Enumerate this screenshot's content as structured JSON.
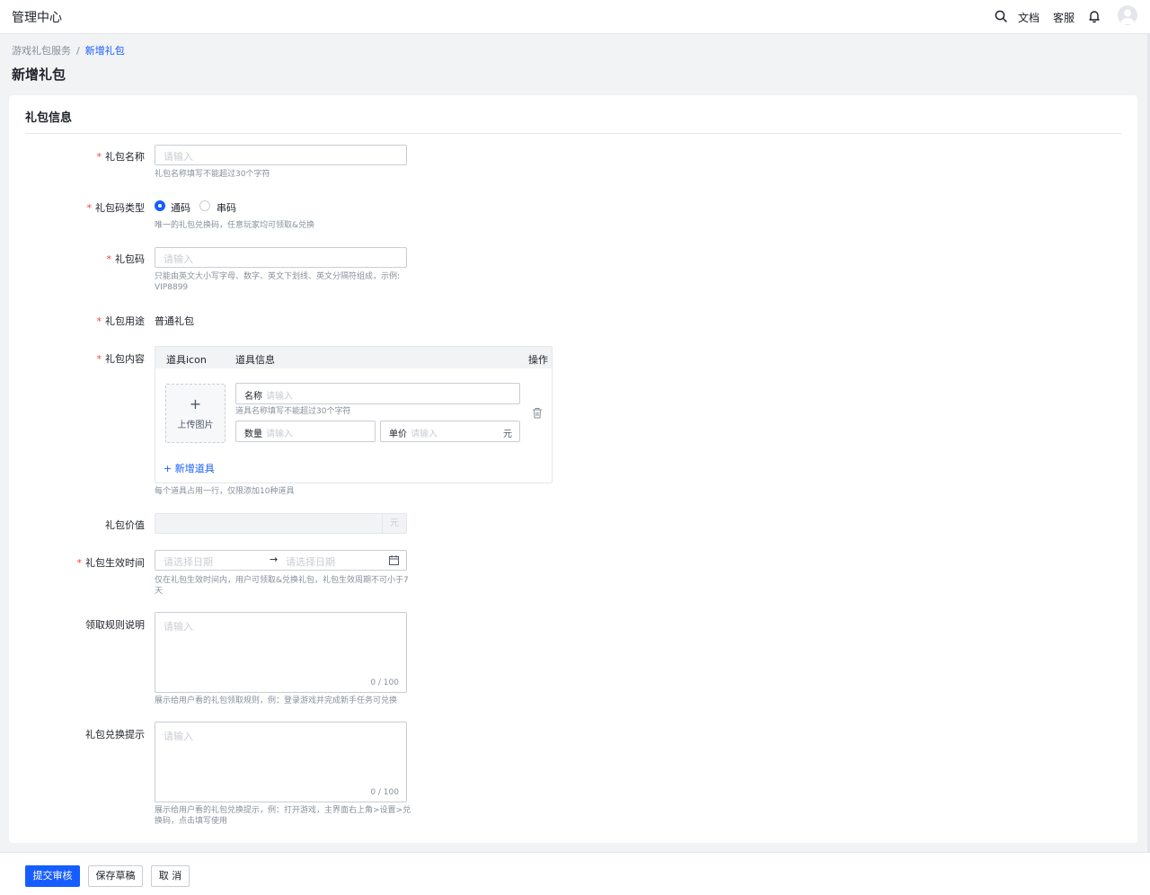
{
  "app": {
    "title": "管理中心"
  },
  "topbar": {
    "docs_label": "文档",
    "support_label": "客服"
  },
  "breadcrumb": {
    "parent": "游戏礼包服务",
    "separator": "/",
    "current": "新增礼包"
  },
  "page_title": "新增礼包",
  "section_title": "礼包信息",
  "form": {
    "name": {
      "label": "礼包名称",
      "placeholder": "请输入",
      "hint": "礼包名称填写不能超过30个字符"
    },
    "code_type": {
      "label": "礼包码类型",
      "options": [
        "通码",
        "串码"
      ],
      "selected": "通码",
      "hint": "唯一的礼包兑换码，任意玩家均可领取&兑换"
    },
    "code": {
      "label": "礼包码",
      "placeholder": "请输入",
      "hint_line1": "只能由英文大小写字母、数字、英文下划线、英文分隔符组成，示例:",
      "hint_line2": "VIP8899"
    },
    "usage": {
      "label": "礼包用途",
      "value": "普通礼包"
    },
    "content": {
      "label": "礼包内容",
      "columns": [
        "道具icon",
        "道具信息",
        "操作"
      ],
      "upload_label": "上传图片",
      "upload_plus": "+",
      "item_name_label": "名称",
      "item_name_placeholder": "请输入",
      "item_name_hint": "道具名称填写不能超过30个字符",
      "qty_label": "数量",
      "qty_placeholder": "请输入",
      "price_label": "单价",
      "price_placeholder": "请输入",
      "price_suffix": "元",
      "add_item": "+ 新增道具",
      "hint": "每个道具占用一行，仅限添加10种道具"
    },
    "value": {
      "label": "礼包价值",
      "suffix": "元"
    },
    "effective_time": {
      "label": "礼包生效时间",
      "start_placeholder": "请选择日期",
      "end_placeholder": "请选择日期",
      "arrow": "→",
      "hint_line1": "仅在礼包生效时间内，用户可领取&兑换礼包，礼包生效周期不可小于7",
      "hint_line2": "天"
    },
    "rules": {
      "label": "领取规则说明",
      "placeholder": "请输入",
      "counter": "0 / 100",
      "hint": "展示给用户看的礼包领取规则，例：登录游戏并完成新手任务可兑换"
    },
    "redeem_tip": {
      "label": "礼包兑换提示",
      "placeholder": "请输入",
      "counter": "0 / 100",
      "hint_line1": "展示给用户看的礼包兑换提示，例：打开游戏，主界面右上角>设置>兑",
      "hint_line2": "换码，点击填写使用"
    }
  },
  "footer": {
    "submit": "提交审核",
    "save_draft": "保存草稿",
    "cancel": "取 消"
  },
  "required_mark": "*",
  "colors": {
    "primary": "#165dff",
    "required": "#f53f3f",
    "border": "#c9cdd4",
    "background": "#f2f3f5"
  }
}
